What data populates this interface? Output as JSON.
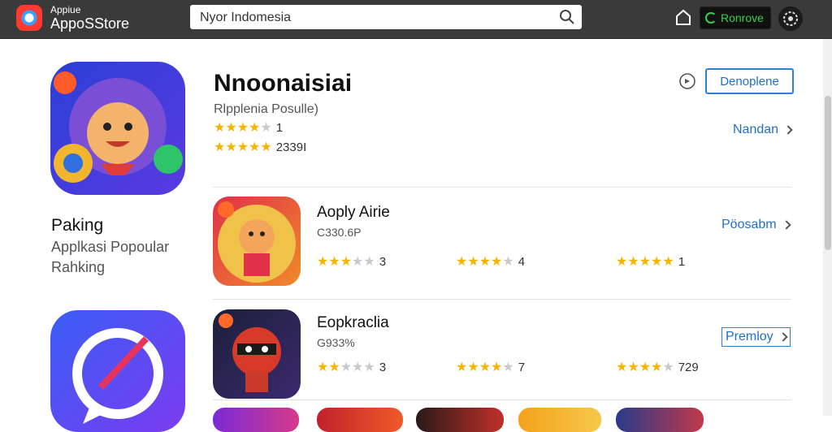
{
  "brand": {
    "small": "Appiue",
    "big": "AppoSStore"
  },
  "search": {
    "value": "Nyor Indomesia"
  },
  "top_button": {
    "label": "Ronrove"
  },
  "left": {
    "title": "Paking",
    "line1": "Applkasi Popoular",
    "line2": "Rahking"
  },
  "header_app": {
    "title": "Nnoonaisiai",
    "subtitle": "Rlpplenia Posulle)",
    "rating1": {
      "stars": 4,
      "text": "1"
    },
    "rating2": {
      "stars": 5,
      "text": "2339I"
    },
    "button_label": "Denoplene",
    "link_label": "Nandan"
  },
  "rows": [
    {
      "title": "Aoply Airie",
      "subtitle": "C330.6P",
      "ratings": [
        {
          "stars": 3,
          "text": "3"
        },
        {
          "stars": 4,
          "text": "4"
        },
        {
          "stars": 5,
          "text": "1"
        }
      ],
      "link_label": "Pöosabm"
    },
    {
      "title": "Eopkraclia",
      "subtitle": "G933%",
      "ratings": [
        {
          "stars": 2,
          "text": "3"
        },
        {
          "stars": 4,
          "text": "7"
        },
        {
          "stars": 4,
          "text": "729"
        }
      ],
      "link_label": "Premloy"
    }
  ],
  "colors": {
    "accent": "#1f6fc9",
    "star": "#f5b400",
    "topbar": "#3a3a3a",
    "green": "#38d14a"
  }
}
